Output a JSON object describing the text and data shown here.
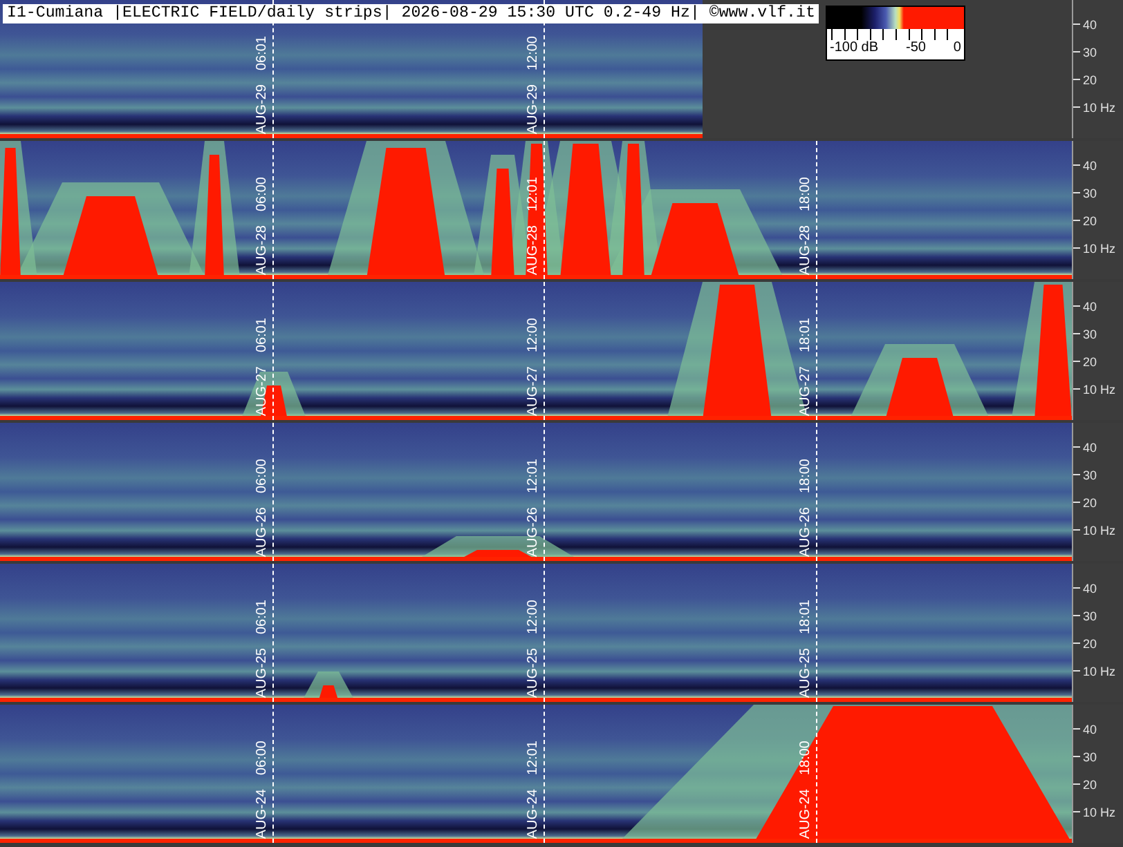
{
  "title": "I1-Cumiana |ELECTRIC FIELD/daily strips| 2026-08-29 15:30 UTC 0.2-49 Hz| ©www.vlf.it",
  "colorbar": {
    "labels": [
      "-100 dB",
      "-50",
      "0"
    ]
  },
  "strips": [
    {
      "kind": "partial",
      "markers": [
        {
          "date": "AUG-29",
          "time": "06:01"
        },
        {
          "date": "AUG-29",
          "time": "12:00"
        }
      ],
      "ticks": [
        "40",
        "30",
        "20",
        "10 Hz"
      ]
    },
    {
      "kind": "full",
      "markers": [
        {
          "date": "AUG-28",
          "time": "06:00"
        },
        {
          "date": "AUG-28",
          "time": "12:01"
        },
        {
          "date": "AUG-28",
          "time": "18:00"
        }
      ],
      "ticks": [
        "40",
        "30",
        "20",
        "10 Hz"
      ]
    },
    {
      "kind": "full",
      "markers": [
        {
          "date": "AUG-27",
          "time": "06:01"
        },
        {
          "date": "AUG-27",
          "time": "12:00"
        },
        {
          "date": "AUG-27",
          "time": "18:01"
        }
      ],
      "ticks": [
        "40",
        "30",
        "20",
        "10 Hz"
      ]
    },
    {
      "kind": "full",
      "markers": [
        {
          "date": "AUG-26",
          "time": "06:00"
        },
        {
          "date": "AUG-26",
          "time": "12:01"
        },
        {
          "date": "AUG-26",
          "time": "18:00"
        }
      ],
      "ticks": [
        "40",
        "30",
        "20",
        "10 Hz"
      ]
    },
    {
      "kind": "full",
      "markers": [
        {
          "date": "AUG-25",
          "time": "06:01"
        },
        {
          "date": "AUG-25",
          "time": "12:00"
        },
        {
          "date": "AUG-25",
          "time": "18:01"
        }
      ],
      "ticks": [
        "40",
        "30",
        "20",
        "10 Hz"
      ]
    },
    {
      "kind": "full",
      "markers": [
        {
          "date": "AUG-24",
          "time": "06:00"
        },
        {
          "date": "AUG-24",
          "time": "12:01"
        },
        {
          "date": "AUG-24",
          "time": "18:00"
        }
      ],
      "ticks": [
        "40",
        "30",
        "20",
        "10 Hz"
      ]
    }
  ]
}
